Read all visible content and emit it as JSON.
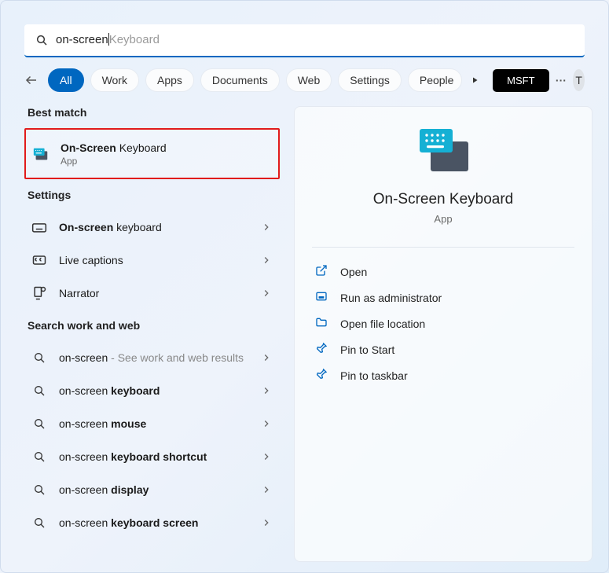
{
  "search": {
    "typed": "on-screen",
    "suggest": "Keyboard"
  },
  "tabs": [
    "All",
    "Work",
    "Apps",
    "Documents",
    "Web",
    "Settings",
    "People"
  ],
  "accountLabel": "MSFT",
  "avatarLetter": "T",
  "sections": {
    "bestMatchHead": "Best match",
    "settingsHead": "Settings",
    "webHead": "Search work and web"
  },
  "bestMatch": {
    "titleBold": "On-Screen",
    "titleRest": " Keyboard",
    "sub": "App"
  },
  "settingsItems": [
    {
      "bold": "On-screen",
      "rest": " keyboard",
      "icon": "keyboard"
    },
    {
      "bold": "",
      "rest": "Live captions",
      "icon": "caption"
    },
    {
      "bold": "",
      "rest": "Narrator",
      "icon": "narrator"
    }
  ],
  "webItems": [
    {
      "prefix": "on-screen",
      "bold": "",
      "tail": " - See work and web results"
    },
    {
      "prefix": "on-screen ",
      "bold": "keyboard",
      "tail": ""
    },
    {
      "prefix": "on-screen ",
      "bold": "mouse",
      "tail": ""
    },
    {
      "prefix": "on-screen ",
      "bold": "keyboard shortcut",
      "tail": ""
    },
    {
      "prefix": "on-screen ",
      "bold": "display",
      "tail": ""
    },
    {
      "prefix": "on-screen ",
      "bold": "keyboard screen",
      "tail": ""
    }
  ],
  "details": {
    "title": "On-Screen Keyboard",
    "sub": "App",
    "actions": [
      {
        "icon": "open",
        "label": "Open"
      },
      {
        "icon": "admin",
        "label": "Run as administrator"
      },
      {
        "icon": "folder",
        "label": "Open file location"
      },
      {
        "icon": "pin",
        "label": "Pin to Start"
      },
      {
        "icon": "pin",
        "label": "Pin to taskbar"
      }
    ]
  }
}
